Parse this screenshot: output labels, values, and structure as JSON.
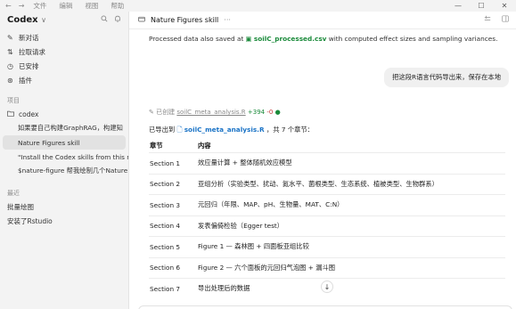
{
  "titlebar": {
    "back": "←",
    "forward": "→",
    "menus": [
      "文件",
      "编辑",
      "视图",
      "帮助"
    ],
    "window_controls": [
      "—",
      "☐",
      "✕"
    ]
  },
  "sidebar": {
    "app_name": "Codex",
    "app_caret": "∨",
    "nav": [
      {
        "icon": "edit-icon",
        "glyph": "✎",
        "label": "新对话"
      },
      {
        "icon": "pull-request-icon",
        "glyph": "⇅",
        "label": "拉取请求"
      },
      {
        "icon": "clock-icon",
        "glyph": "◷",
        "label": "已安排"
      },
      {
        "icon": "plugin-icon",
        "glyph": "⊛",
        "label": "插件"
      }
    ],
    "projects_label": "项目",
    "project_name": "codex",
    "threads": [
      {
        "label": "如果要自己构建GraphRAG，构建知",
        "active": false
      },
      {
        "label": "Nature Figures skill",
        "active": true
      },
      {
        "label": "\"Install the Codex skills from this re",
        "active": false
      },
      {
        "label": "$nature-figure 帮我绘制几个Nature",
        "active": false
      }
    ],
    "recent_label": "最近",
    "recent": [
      "批量绘图",
      "安装了Rstudio"
    ]
  },
  "main": {
    "title": "Nature Figures skill",
    "more": "···",
    "processed_prefix": "Processed data also saved at",
    "processed_file": "soilC_processed.csv",
    "processed_suffix": "with computed effect sizes and sampling variances.",
    "user_message": "把这段R语言代码导出来，保存在本地",
    "created_label": "已创建",
    "created_file": "soilC_meta_analysis.R",
    "created_add": "+394",
    "created_del": "-0",
    "exported_prefix": "已导出到",
    "exported_file": "soilC_meta_analysis.R",
    "exported_suffix": "，共 7 个章节：",
    "table": {
      "headers": [
        "章节",
        "内容"
      ],
      "rows": [
        [
          "Section 1",
          "效应量计算 + 整体随机效应模型"
        ],
        [
          "Section 2",
          "亚组分析（实验类型、扰动、氮水平、菌根类型、生态系统、植被类型、生物群系）"
        ],
        [
          "Section 3",
          "元回归（年限、MAP、pH、生物量、MAT、C:N）"
        ],
        [
          "Section 4",
          "发表偏倚检验（Egger test）"
        ],
        [
          "Section 5",
          "Figure 1 — 森林图 + 四面板亚组比较"
        ],
        [
          "Section 6",
          "Figure 2 — 六个面板的元回归气泡图 + 漏斗图"
        ],
        [
          "Section 7",
          "导出处理后的数据"
        ]
      ]
    },
    "scroll_down": "↓"
  }
}
